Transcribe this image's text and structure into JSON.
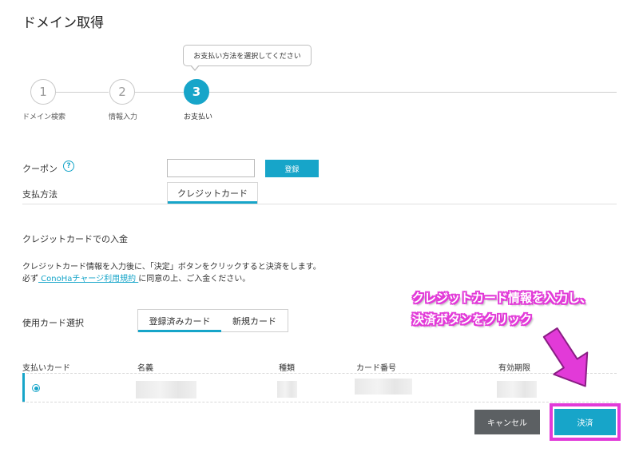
{
  "page": {
    "title": "ドメイン取得"
  },
  "tooltip": {
    "text": "お支払い方法を選択してください"
  },
  "steps": [
    {
      "number": "1",
      "label": "ドメイン検索"
    },
    {
      "number": "2",
      "label": "情報入力"
    },
    {
      "number": "3",
      "label": "お支払い"
    }
  ],
  "coupon": {
    "label": "クーポン",
    "help": "?",
    "value": "",
    "register_label": "登録"
  },
  "payment_method": {
    "label": "支払方法",
    "tab": "クレジットカード"
  },
  "credit_section": {
    "heading": "クレジットカードでの入金",
    "line1": "クレジットカード情報を入力後に、「決定」ボタンをクリックすると決済をします。",
    "line2_prefix": "必ず",
    "line2_link": " ConoHaチャージ利用規約 ",
    "line2_suffix": "に同意の上、ご入金ください。"
  },
  "card_select": {
    "label": "使用カード選択",
    "tabs": [
      "登録済みカード",
      "新規カード"
    ]
  },
  "table": {
    "headers": [
      "支払いカード",
      "名義",
      "種類",
      "カード番号",
      "有効期限"
    ]
  },
  "buttons": {
    "cancel": "キャンセル",
    "pay": "決済"
  },
  "annotation": {
    "line1": "クレジットカード情報を入力し、",
    "line2": "決済ボタンをクリック"
  },
  "colors": {
    "accent": "#17a5c9",
    "highlight": "#e23ad8",
    "cancel": "#5c6063"
  }
}
